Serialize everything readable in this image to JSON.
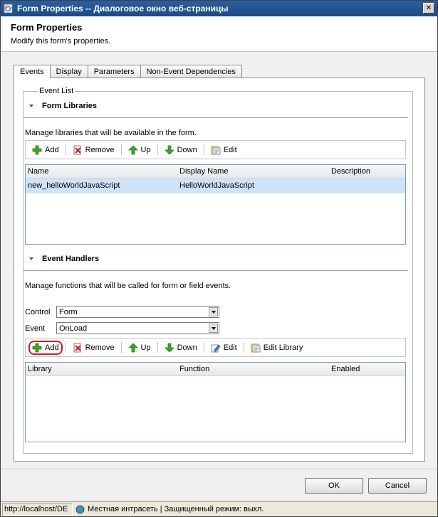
{
  "window": {
    "title": "Form Properties -- Диалоговое окно веб-страницы",
    "close_label": "✕"
  },
  "header": {
    "title": "Form Properties",
    "subtitle": "Modify this form's properties."
  },
  "tabs": [
    {
      "label": "Events",
      "active": true
    },
    {
      "label": "Display"
    },
    {
      "label": "Parameters"
    },
    {
      "label": "Non-Event Dependencies"
    }
  ],
  "event_list": {
    "legend": "Event List",
    "form_libraries": {
      "title": "Form Libraries",
      "description": "Manage libraries that will be available in the form.",
      "toolbar": {
        "add": "Add",
        "remove": "Remove",
        "up": "Up",
        "down": "Down",
        "edit": "Edit"
      },
      "columns": [
        "Name",
        "Display Name",
        "Description"
      ],
      "rows": [
        {
          "name": "new_helloWorldJavaScript",
          "display_name": "HelloWorldJavaScript",
          "description": ""
        }
      ]
    },
    "event_handlers": {
      "title": "Event Handlers",
      "description": "Manage functions that will be called for form or field events.",
      "control_label": "Control",
      "control_value": "Form",
      "event_label": "Event",
      "event_value": "OnLoad",
      "toolbar": {
        "add": "Add",
        "remove": "Remove",
        "up": "Up",
        "down": "Down",
        "edit": "Edit",
        "edit_library": "Edit Library"
      },
      "columns": [
        "Library",
        "Function",
        "Enabled"
      ],
      "rows": []
    }
  },
  "footer": {
    "ok": "OK",
    "cancel": "Cancel"
  },
  "statusbar": {
    "url": "http://localhost/DE",
    "zone": "Местная интрасеть | Защищенный режим: выкл."
  },
  "colors": {
    "titlebar": "#1c4a86",
    "selected_row": "#cfe3f6",
    "highlight": "#d41a1a",
    "accent_triangle": "#1f5aa6"
  }
}
